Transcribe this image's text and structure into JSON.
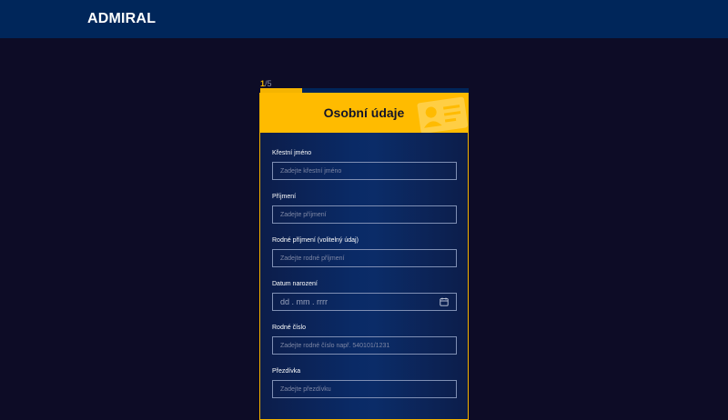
{
  "brand": {
    "logo_text": "ADMIRAL"
  },
  "step": {
    "current": "1",
    "total": "/5",
    "progress_fraction": 0.2
  },
  "form": {
    "title": "Osobní údaje",
    "fields": [
      {
        "label": "Křestní jméno",
        "placeholder": "Zadejte křestní jméno"
      },
      {
        "label": "Příjmení",
        "placeholder": "Zadejte příjmení"
      },
      {
        "label": "Rodné příjmení (volitelný údaj)",
        "placeholder": "Zadejte rodné příjmení"
      },
      {
        "label": "Datum narození",
        "placeholder": "dd . mm . rrrr"
      },
      {
        "label": "Rodné číslo",
        "placeholder": "Zadejte rodné číslo např. 540101/1231"
      },
      {
        "label": "Přezdívka",
        "placeholder": "Zadejte přezdívku"
      }
    ]
  },
  "colors": {
    "header_bg": "#00265a",
    "page_bg": "#0d0c26",
    "accent": "#ffbb00"
  },
  "icons": {
    "date": "calendar-icon",
    "header_decoration": "id-card-icon"
  }
}
